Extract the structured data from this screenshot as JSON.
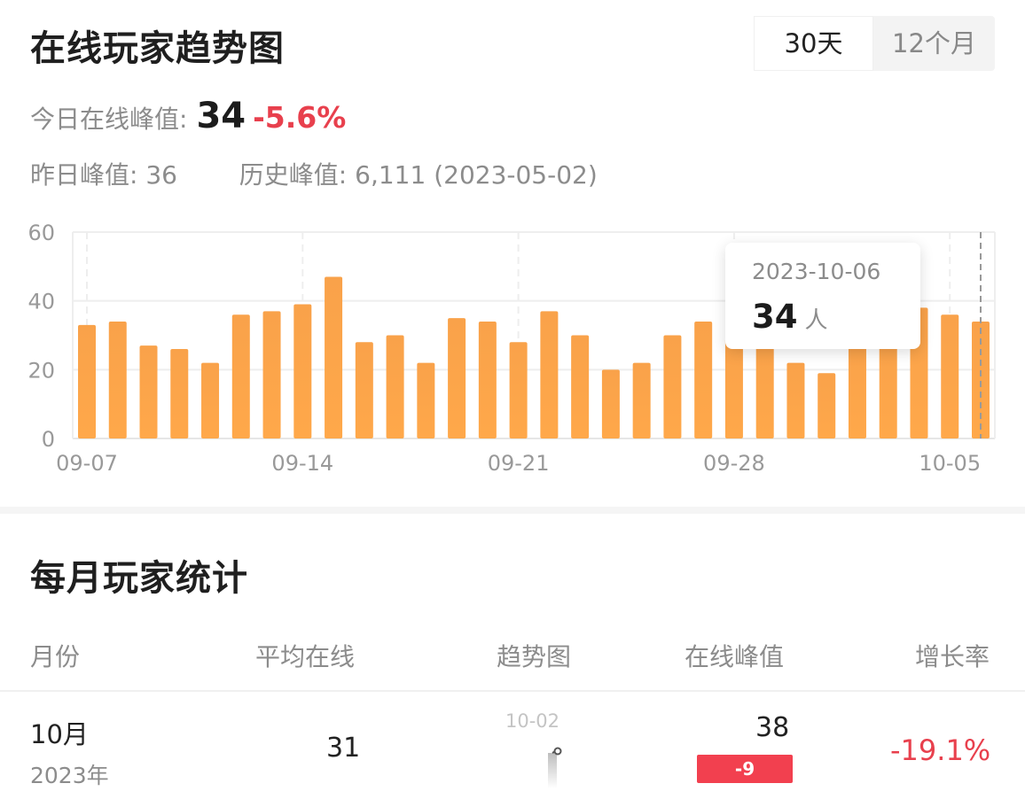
{
  "header": {
    "title": "在线玩家趋势图"
  },
  "range_toggle": {
    "options": [
      "30天",
      "12个月"
    ],
    "selected": "30天"
  },
  "today_peak": {
    "label": "今日在线峰值:",
    "value": "34",
    "change": "-5.6%"
  },
  "yesterday_peak": {
    "label": "昨日峰值:",
    "value": "36"
  },
  "history_peak": {
    "label": "历史峰值:",
    "value": "6,111 (2023-05-02)"
  },
  "colors": {
    "bar": "#ffa84a",
    "bar_top": "#f9a24a",
    "negative": "#e8404d",
    "badge": "#f2404f"
  },
  "chart_data": {
    "type": "bar",
    "x": [
      "09-07",
      "09-08",
      "09-09",
      "09-10",
      "09-11",
      "09-12",
      "09-13",
      "09-14",
      "09-15",
      "09-16",
      "09-17",
      "09-18",
      "09-19",
      "09-20",
      "09-21",
      "09-22",
      "09-23",
      "09-24",
      "09-25",
      "09-26",
      "09-27",
      "09-28",
      "09-29",
      "09-30",
      "10-01",
      "10-02",
      "10-03",
      "10-04",
      "10-05",
      "10-06"
    ],
    "values": [
      33,
      34,
      27,
      26,
      22,
      36,
      37,
      39,
      47,
      28,
      30,
      22,
      35,
      34,
      28,
      37,
      30,
      20,
      22,
      30,
      34,
      29,
      28,
      22,
      19,
      28,
      29,
      38,
      36,
      34
    ],
    "xticks": [
      "09-07",
      "09-14",
      "09-21",
      "09-28",
      "10-05"
    ],
    "yticks": [
      0,
      20,
      40,
      60
    ],
    "ylim": [
      0,
      60
    ],
    "grid": true,
    "tooltip": {
      "date": "2023-10-06",
      "value": "34",
      "unit": "人"
    }
  },
  "monthly": {
    "title": "每月玩家统计",
    "columns": [
      "月份",
      "平均在线",
      "趋势图",
      "在线峰值",
      "增长率"
    ],
    "rows": [
      {
        "month": "10月",
        "year": "2023年",
        "avg": "31",
        "spark_label": "10-02",
        "peak": "38",
        "peak_diff": "-9",
        "growth": "-19.1%"
      }
    ]
  }
}
